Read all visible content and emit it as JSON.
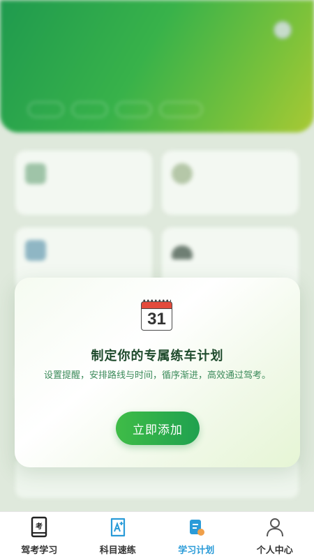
{
  "modal": {
    "calendar_day": "31",
    "title": "制定你的专属练车计划",
    "description": "设置提醒，安排路线与时间，循序渐进，高效通过驾考。",
    "button_label": "立即添加"
  },
  "tabs": [
    {
      "label": "驾考学习",
      "icon": "exam-book-icon",
      "active": false
    },
    {
      "label": "科目速练",
      "icon": "a-plus-icon",
      "active": false
    },
    {
      "label": "学习计划",
      "icon": "plan-document-icon",
      "active": true
    },
    {
      "label": "个人中心",
      "icon": "person-icon",
      "active": false
    }
  ],
  "colors": {
    "accent_green": "#1fa14f",
    "active_tab_blue": "#2a9bd8",
    "hero_green": "#38b24a"
  }
}
